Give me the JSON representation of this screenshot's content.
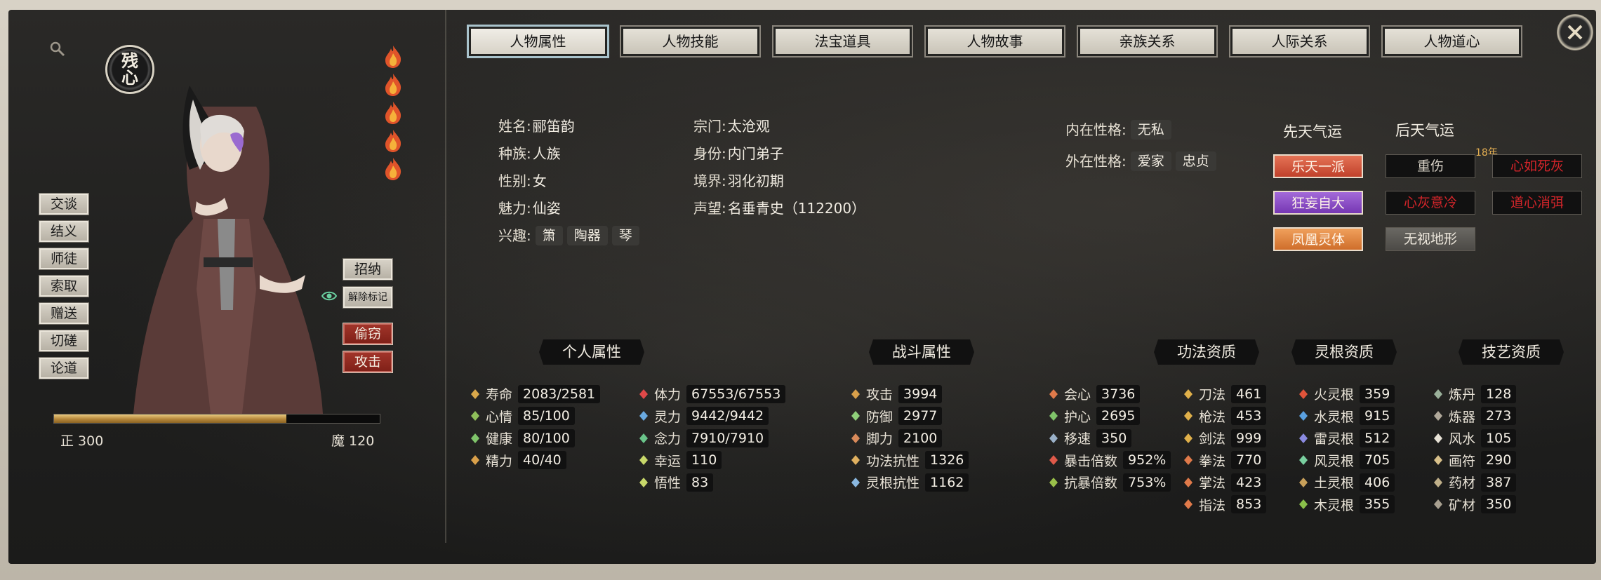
{
  "left": {
    "badge_text": "残心",
    "actions": [
      "交谈",
      "结义",
      "师徒",
      "索取",
      "赠送",
      "切磋",
      "论道"
    ],
    "recruit_label": "招纳",
    "unmark_label": "解除标记",
    "steal_label": "偷窃",
    "attack_label": "攻击",
    "righteous": "正 300",
    "demonic": "魔 120",
    "righteous_fraction": 0.714,
    "flame_count": 5
  },
  "tabs": [
    "人物属性",
    "人物技能",
    "法宝道具",
    "人物故事",
    "亲族关系",
    "人际关系",
    "人物道心"
  ],
  "active_tab": 0,
  "profile": {
    "name_label": "姓名:",
    "name": "郦笛韵",
    "race_label": "种族:",
    "race": "人族",
    "gender_label": "性别:",
    "gender": "女",
    "charm_label": "魅力:",
    "charm": "仙姿",
    "hobby_label": "兴趣:",
    "hobbies": [
      "箫",
      "陶器",
      "琴"
    ],
    "sect_label": "宗门:",
    "sect": "太沧观",
    "identity_label": "身份:",
    "identity": "内门弟子",
    "realm_label": "境界:",
    "realm": "羽化初期",
    "fame_label": "声望:",
    "fame": "名垂青史（112200）",
    "inner_label": "内在性格:",
    "inner": "无私",
    "outer_label": "外在性格:",
    "outer": [
      "爱家",
      "忠贞"
    ]
  },
  "luck": {
    "innate_title": "先天气运",
    "acquired_title": "后天气运",
    "innate": [
      "乐天一派",
      "狂妄自大",
      "凤凰灵体"
    ],
    "acquired_col1": [
      "重伤",
      "心灰意冷",
      "无视地形"
    ],
    "acquired_col2": [
      "心如死灰",
      "道心消弭"
    ],
    "injury_note": "18年"
  },
  "sections": {
    "personal": "个人属性",
    "combat": "战斗属性",
    "skill_aptitude": "功法资质",
    "root_aptitude": "灵根资质",
    "art_aptitude": "技艺资质"
  },
  "personal_a": [
    {
      "name": "寿命",
      "value": "2083/2581",
      "icon": "lifespan-icon",
      "color": "#d9a84a"
    },
    {
      "name": "心情",
      "value": "85/100",
      "icon": "mood-icon",
      "color": "#8fbf5a"
    },
    {
      "name": "健康",
      "value": "80/100",
      "icon": "health-icon",
      "color": "#7fc46a"
    },
    {
      "name": "精力",
      "value": "40/40",
      "icon": "energy-icon",
      "color": "#d9a04a"
    }
  ],
  "personal_b": [
    {
      "name": "体力",
      "value": "67553/67553",
      "icon": "heart-icon",
      "color": "#e04848"
    },
    {
      "name": "灵力",
      "value": "9442/9442",
      "icon": "spirit-icon",
      "color": "#6aa9e0"
    },
    {
      "name": "念力",
      "value": "7910/7910",
      "icon": "mind-eye-icon",
      "color": "#6ac48a"
    },
    {
      "name": "幸运",
      "value": "110",
      "icon": "luck-moon-icon",
      "color": "#c8d86a"
    },
    {
      "name": "悟性",
      "value": "83",
      "icon": "insight-icon",
      "color": "#c8d86a"
    }
  ],
  "combat_a": [
    {
      "name": "攻击",
      "value": "3994",
      "icon": "attack-icon",
      "color": "#d9a04a"
    },
    {
      "name": "防御",
      "value": "2977",
      "icon": "defense-icon",
      "color": "#8fd07a"
    },
    {
      "name": "脚力",
      "value": "2100",
      "icon": "footwork-icon",
      "color": "#d98a5a"
    },
    {
      "name": "功法抗性",
      "value": "1326",
      "icon": "skill-resist-icon",
      "color": "#e0b060"
    },
    {
      "name": "灵根抗性",
      "value": "1162",
      "icon": "root-resist-icon",
      "color": "#8ab8e0"
    }
  ],
  "combat_b": [
    {
      "name": "会心",
      "value": "3736",
      "icon": "critical-icon",
      "color": "#e07a4a"
    },
    {
      "name": "护心",
      "value": "2695",
      "icon": "guard-icon",
      "color": "#7fc46a"
    },
    {
      "name": "移速",
      "value": "350",
      "icon": "speed-icon",
      "color": "#9ab0c8"
    },
    {
      "name": "暴击倍数",
      "value": "952%",
      "icon": "crit-mult-icon",
      "color": "#e05a4a"
    },
    {
      "name": "抗暴倍数",
      "value": "753%",
      "icon": "crit-resist-icon",
      "color": "#9ac04a"
    }
  ],
  "skills": [
    {
      "name": "刀法",
      "value": "461",
      "icon": "saber-icon",
      "color": "#e0b04a"
    },
    {
      "name": "枪法",
      "value": "453",
      "icon": "spear-icon",
      "color": "#e0b04a"
    },
    {
      "name": "剑法",
      "value": "999",
      "icon": "sword-icon",
      "color": "#e0b04a"
    },
    {
      "name": "拳法",
      "value": "770",
      "icon": "fist-icon",
      "color": "#e07a4a"
    },
    {
      "name": "掌法",
      "value": "423",
      "icon": "palm-icon",
      "color": "#e07a4a"
    },
    {
      "name": "指法",
      "value": "853",
      "icon": "finger-icon",
      "color": "#e07a4a"
    }
  ],
  "roots": [
    {
      "name": "火灵根",
      "value": "359",
      "icon": "fire-root-icon",
      "color": "#e0543a"
    },
    {
      "name": "水灵根",
      "value": "915",
      "icon": "water-root-icon",
      "color": "#5aa0e0"
    },
    {
      "name": "雷灵根",
      "value": "512",
      "icon": "thunder-root-icon",
      "color": "#8a8ae0"
    },
    {
      "name": "风灵根",
      "value": "705",
      "icon": "wind-root-icon",
      "color": "#7ad0a0"
    },
    {
      "name": "土灵根",
      "value": "406",
      "icon": "earth-root-icon",
      "color": "#c8a05a"
    },
    {
      "name": "木灵根",
      "value": "355",
      "icon": "wood-root-icon",
      "color": "#8ac04a"
    }
  ],
  "arts": [
    {
      "name": "炼丹",
      "value": "128",
      "icon": "alchemy-icon",
      "color": "#9ab09a"
    },
    {
      "name": "炼器",
      "value": "273",
      "icon": "forge-icon",
      "color": "#b0a89a"
    },
    {
      "name": "风水",
      "value": "105",
      "icon": "fengshui-icon",
      "color": "#e8e2d6"
    },
    {
      "name": "画符",
      "value": "290",
      "icon": "talisman-icon",
      "color": "#d8c08a"
    },
    {
      "name": "药材",
      "value": "387",
      "icon": "herb-icon",
      "color": "#c0b08a"
    },
    {
      "name": "矿材",
      "value": "350",
      "icon": "ore-icon",
      "color": "#a8a090"
    }
  ]
}
